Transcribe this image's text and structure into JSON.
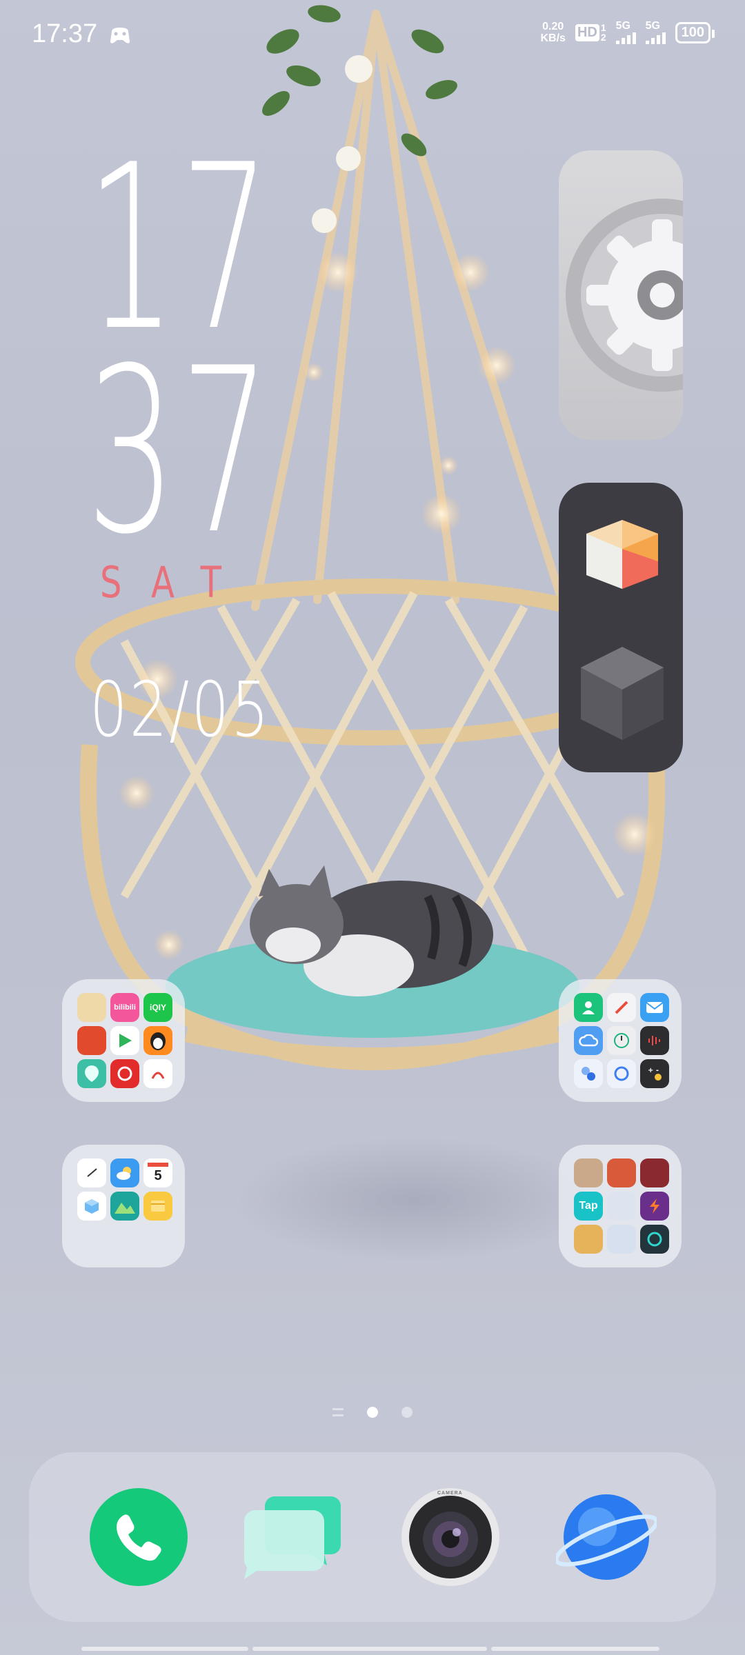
{
  "status_bar": {
    "time": "17:37",
    "net_speed_value": "0.20",
    "net_speed_unit": "KB/s",
    "hd_label": "HD",
    "hd_sub_top": "1",
    "hd_sub_bottom": "2",
    "sim1_label": "5G",
    "sim2_label": "5G",
    "battery": "100"
  },
  "clock_widget": {
    "hours": "17",
    "minutes": "37",
    "day": "SAT",
    "date": "02/05"
  },
  "widgets": {
    "settings_icon": "gear-icon",
    "cube_icons": [
      "colored-cube-icon",
      "dark-cube-icon"
    ]
  },
  "folders": {
    "folder_1": {
      "icons": [
        "manga-app",
        "bilibili",
        "iqiyi",
        "game-app",
        "play-store",
        "penguin-app",
        "map-pin-app",
        "netease-music",
        "notes-app"
      ],
      "labels": [
        "bilibili",
        "iQIY"
      ]
    },
    "folder_2": {
      "icons": [
        "contacts",
        "compass",
        "mail",
        "cloud",
        "clock",
        "recorder",
        "assistant",
        "sync",
        "calculator"
      ]
    },
    "folder_3": {
      "icons": [
        "clock",
        "weather",
        "calendar",
        "cube-app",
        "photos",
        "notes"
      ],
      "calendar_day": "5"
    },
    "folder_4": {
      "icons": [
        "game-1",
        "game-2",
        "game-3",
        "taptap",
        "game-5",
        "game-6",
        "game-7",
        "game-8",
        "game-9"
      ],
      "taptap_label": "Tap"
    }
  },
  "dock": {
    "apps": [
      "phone-icon",
      "messages-icon",
      "camera-icon",
      "browser-icon"
    ],
    "camera_label": "CAMERA"
  },
  "colors": {
    "phone": "#14c97a",
    "day_text": "#e8707a"
  }
}
